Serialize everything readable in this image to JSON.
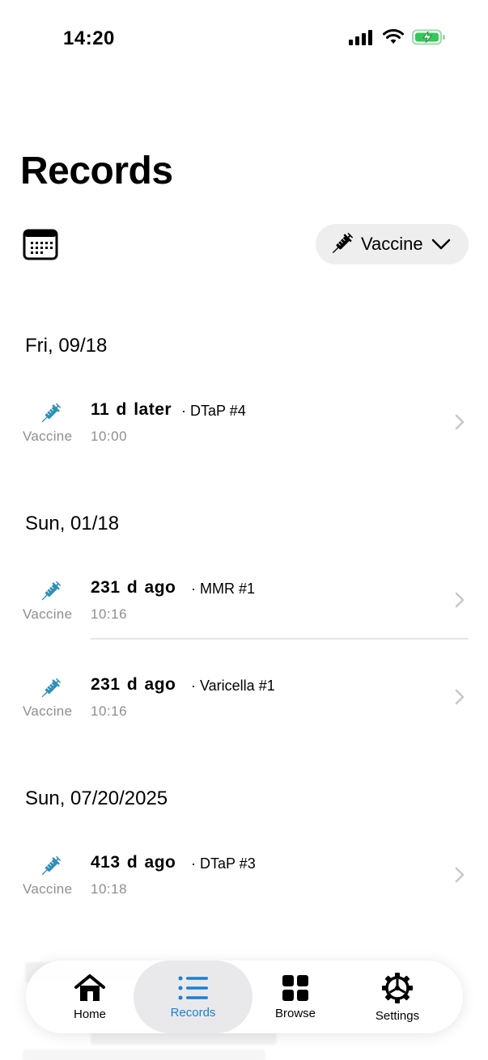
{
  "status_bar": {
    "time": "14:20"
  },
  "page": {
    "title": "Records"
  },
  "filter": {
    "label": "Vaccine"
  },
  "sections": [
    {
      "date": "Fri, 09/18"
    },
    {
      "date": "Sun, 01/18"
    },
    {
      "date": "Sun, 07/20/2025"
    }
  ],
  "records": [
    {
      "type": "Vaccine",
      "relative": "11 d later",
      "name": "· DTaP #4",
      "time": "10:00"
    },
    {
      "type": "Vaccine",
      "relative": "231 d  ago",
      "name": "· MMR #1",
      "time": "10:16"
    },
    {
      "type": "Vaccine",
      "relative": "231 d  ago",
      "name": "· Varicella #1",
      "time": "10:16"
    },
    {
      "type": "Vaccine",
      "relative": "413 d  ago",
      "name": "· DTaP #3",
      "time": "10:18"
    }
  ],
  "tabs": [
    {
      "label": "Home"
    },
    {
      "label": "Records"
    },
    {
      "label": "Browse"
    },
    {
      "label": "Settings"
    }
  ],
  "colors": {
    "accent": "#1a7fd6",
    "syringe": "#2e8fb8",
    "battery": "#34c759"
  }
}
